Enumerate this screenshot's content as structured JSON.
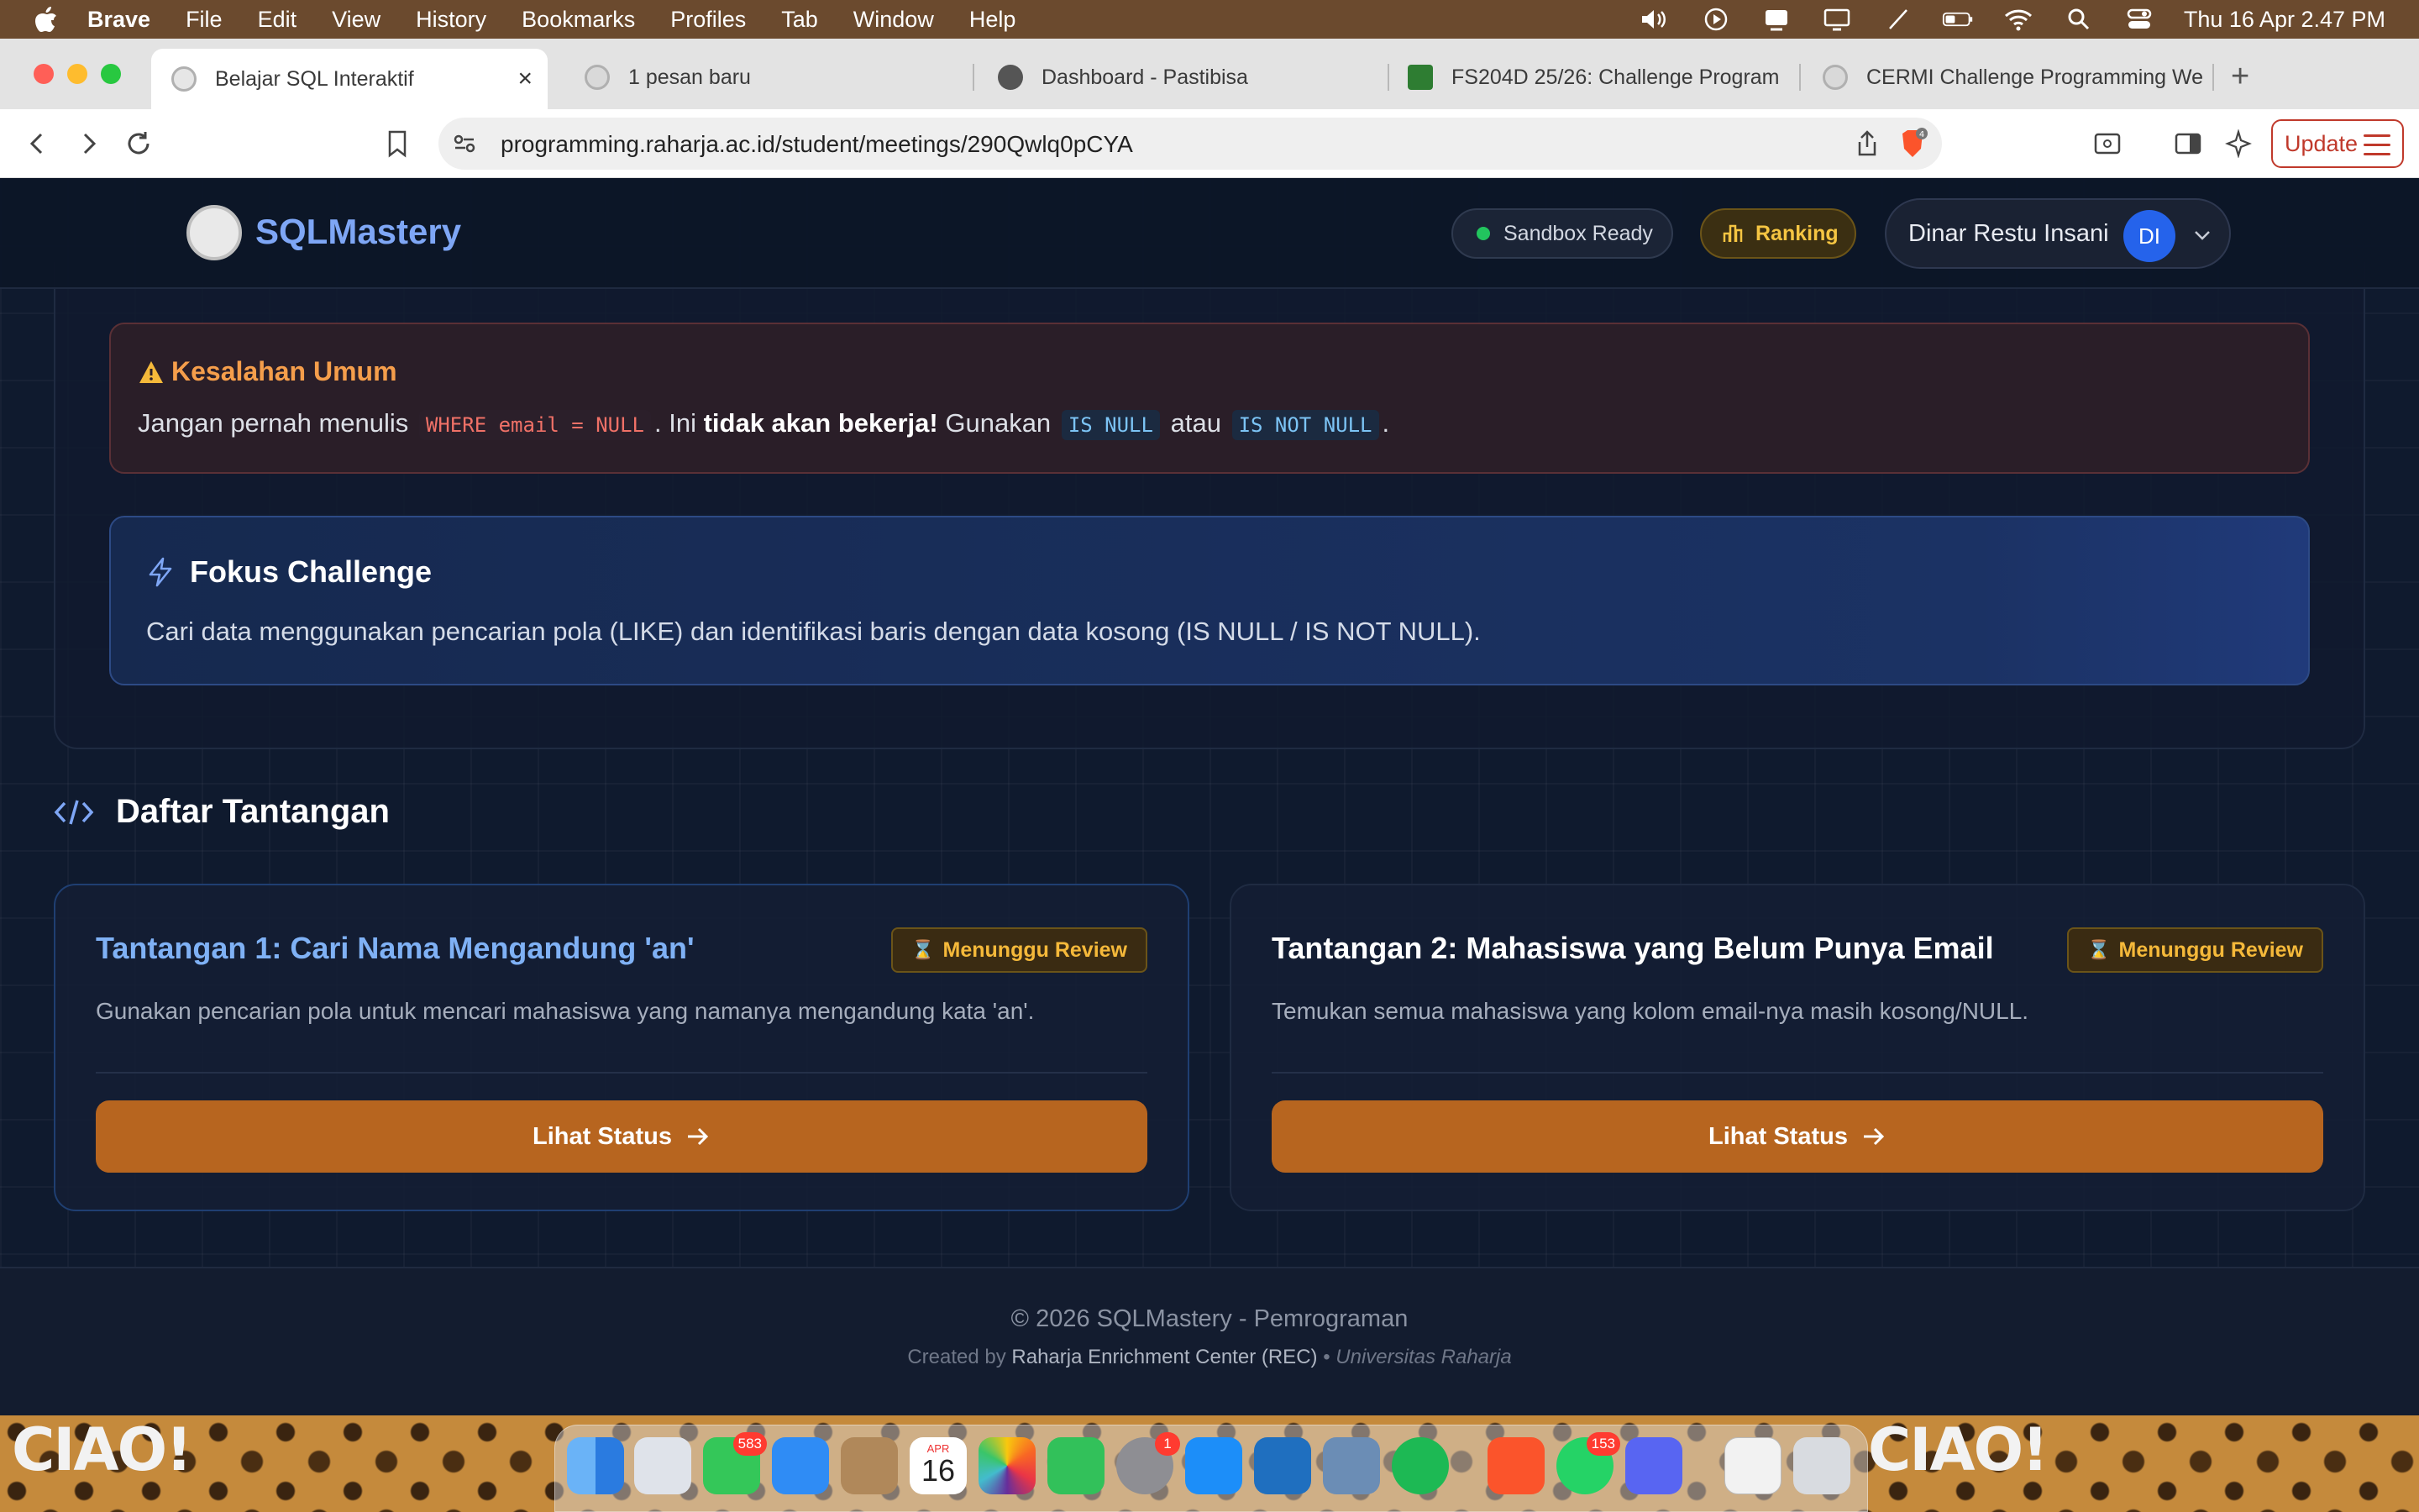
{
  "menubar": {
    "app": "Brave",
    "items": [
      "File",
      "Edit",
      "View",
      "History",
      "Bookmarks",
      "Profiles",
      "Tab",
      "Window",
      "Help"
    ],
    "clock": "Thu 16 Apr  2.47 PM"
  },
  "tabs": [
    {
      "title": "Belajar SQL Interaktif",
      "active": true
    },
    {
      "title": "1 pesan baru"
    },
    {
      "title": "Dashboard - Pastibisa"
    },
    {
      "title": "FS204D 25/26: Challenge Program"
    },
    {
      "title": "CERMI Challenge Programming We"
    }
  ],
  "toolbar": {
    "url": "programming.raharja.ac.id/student/meetings/290Qwlq0pCYA",
    "shield_count": "4",
    "update_label": "Update"
  },
  "header": {
    "logo_text": "SQLMastery",
    "sandbox_label": "Sandbox Ready",
    "ranking_label": "Ranking",
    "user_name": "Dinar Restu Insani",
    "avatar_initials": "DI"
  },
  "warning": {
    "title": "Kesalahan Umum",
    "text_1": "Jangan pernah menulis",
    "code_1": "WHERE email = NULL",
    "text_2": ". Ini",
    "bold": "tidak akan bekerja!",
    "text_3": "Gunakan",
    "code_2": "IS NULL",
    "text_4": "atau",
    "code_3": "IS NOT NULL",
    "text_5": "."
  },
  "focus": {
    "title": "Fokus Challenge",
    "text": "Cari data menggunakan pencarian pola (LIKE) dan identifikasi baris dengan data kosong (IS NULL / IS NOT NULL)."
  },
  "challenges": {
    "section_title": "Daftar Tantangan",
    "items": [
      {
        "title": "Tantangan 1: Cari Nama Mengandung 'an'",
        "badge": "Menunggu Review",
        "desc": "Gunakan pencarian pola untuk mencari mahasiswa yang namanya mengandung kata 'an'.",
        "button": "Lihat Status"
      },
      {
        "title": "Tantangan 2: Mahasiswa yang Belum Punya Email",
        "badge": "Menunggu Review",
        "desc": "Temukan semua mahasiswa yang kolom email-nya masih kosong/NULL.",
        "button": "Lihat Status"
      }
    ]
  },
  "footer": {
    "copyright": "© 2026 SQLMastery - Pemrograman",
    "created_by": "Created by",
    "rec": "Raharja Enrichment Center (REC)",
    "separator": "•",
    "university": "Universitas Raharja"
  },
  "desktop": {
    "wallpaper_text": "CIAO!",
    "dock_badges": {
      "messages": "583",
      "settings": "1",
      "whatsapp": "153"
    },
    "calendar_month": "APR",
    "calendar_day": "16"
  },
  "colors": {
    "accent_blue": "#7ea6f5",
    "button_orange": "#b7651f",
    "warning_orange": "#f59e4b",
    "badge_yellow": "#f5b93a"
  }
}
